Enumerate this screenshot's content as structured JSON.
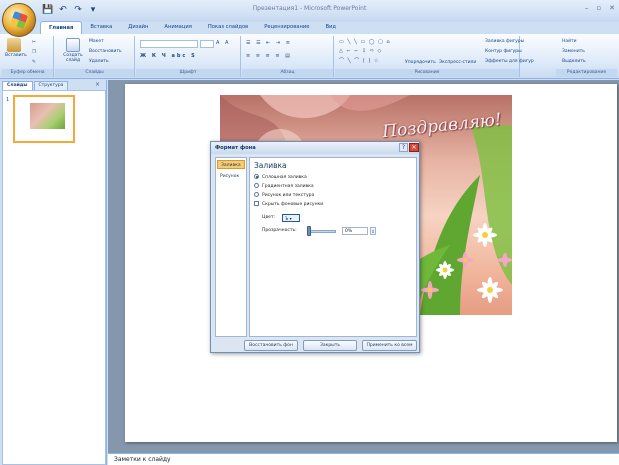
{
  "app": {
    "title": "Презентация1 - Microsoft PowerPoint",
    "window_controls": [
      "–",
      "▫",
      "✕"
    ]
  },
  "qat": [
    "💾",
    "↶",
    "↷",
    "▾"
  ],
  "tabs": [
    {
      "label": "Главная",
      "active": true
    },
    {
      "label": "Вставка"
    },
    {
      "label": "Дизайн"
    },
    {
      "label": "Анимация"
    },
    {
      "label": "Показ слайдов"
    },
    {
      "label": "Рецензирование"
    },
    {
      "label": "Вид"
    }
  ],
  "ribbon": {
    "groups": {
      "clipboard": "Буфер обмена",
      "slides": "Слайды",
      "font": "Шрифт",
      "paragraph": "Абзац",
      "drawing": "Рисование",
      "editing": "Редактирование"
    },
    "paste": "Вставить",
    "create_slide": "Создать слайд",
    "layout": "Макет",
    "reset": "Восстановить",
    "delete": "Удалить",
    "arrange": "Упорядочить",
    "quick_styles": "Экспресс-стили",
    "shape_fill": "Заливка фигуры",
    "shape_outline": "Контур фигуры",
    "shape_effects": "Эффекты для фигур",
    "find": "Найти",
    "replace": "Заменить",
    "select": "Выделить"
  },
  "left_pane": {
    "tabs": [
      "Слайды",
      "Структура"
    ],
    "close": "×",
    "slide_number": "1"
  },
  "slide": {
    "greeting": "Поздравляю!"
  },
  "notes": {
    "placeholder": "Заметки к слайду"
  },
  "dialog": {
    "title": "Формат фона",
    "help": "?",
    "close": "✕",
    "nav": [
      {
        "label": "Заливка",
        "selected": true
      },
      {
        "label": "Рисунок",
        "selected": false
      }
    ],
    "heading": "Заливка",
    "options": {
      "solid": "Сплошная заливка",
      "gradient": "Градиентная заливка",
      "picture": "Рисунок или текстура",
      "hide_bg": "Скрыть фоновые рисунки"
    },
    "color_label": "Цвет:",
    "color_value": "Ъ ▾",
    "transparency_label": "Прозрачность:",
    "transparency_value": "0%",
    "spin": "⇕",
    "buttons": {
      "reset": "Восстановить фон",
      "close": "Закрыть",
      "apply_all": "Применить ко всем"
    }
  },
  "colors": {
    "accent": "#15428b",
    "selection": "#f5a93a",
    "close_red": "#d9463a"
  }
}
